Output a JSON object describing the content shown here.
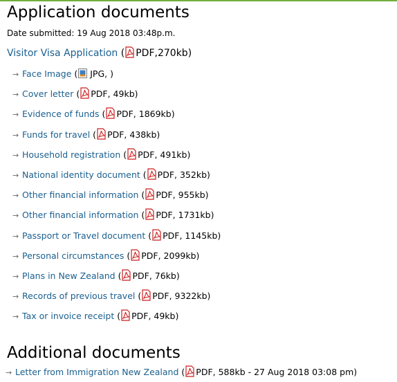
{
  "sections": {
    "application_title": "Application documents",
    "date_submitted": "Date submitted: 19 Aug 2018  03:48p.m.",
    "main_document": {
      "label": "Visitor Visa Application",
      "type": "PDF",
      "size": "270kb"
    },
    "documents": [
      {
        "label": "Face Image",
        "type": "JPG",
        "size": ""
      },
      {
        "label": "Cover letter",
        "type": "PDF",
        "size": "49kb"
      },
      {
        "label": "Evidence of funds",
        "type": "PDF",
        "size": "1869kb"
      },
      {
        "label": "Funds for travel",
        "type": "PDF",
        "size": "438kb"
      },
      {
        "label": "Household registration",
        "type": "PDF",
        "size": "491kb"
      },
      {
        "label": "National identity document",
        "type": "PDF",
        "size": "352kb"
      },
      {
        "label": "Other financial information",
        "type": "PDF",
        "size": "955kb"
      },
      {
        "label": "Other financial information",
        "type": "PDF",
        "size": "1731kb"
      },
      {
        "label": "Passport or Travel document",
        "type": "PDF",
        "size": "1145kb"
      },
      {
        "label": "Personal circumstances",
        "type": "PDF",
        "size": "2099kb"
      },
      {
        "label": "Plans in New Zealand",
        "type": "PDF",
        "size": "76kb"
      },
      {
        "label": "Records of previous travel",
        "type": "PDF",
        "size": "9322kb"
      },
      {
        "label": "Tax or invoice receipt",
        "type": "PDF",
        "size": "49kb"
      }
    ],
    "additional_title": "Additional documents",
    "additional_documents": [
      {
        "label": "Letter from Immigration New Zealand",
        "type": "PDF",
        "size": "588kb",
        "date": "27 Aug 2018 03:08 pm"
      }
    ]
  },
  "colors": {
    "link": "#1a5f8f",
    "pdf_icon": "#cc1f1f",
    "top_rule": "#6fae3c"
  },
  "icons": {
    "pdf": "pdf-file-icon",
    "jpg": "image-file-icon",
    "bullet": "arrow-bullet-icon"
  }
}
